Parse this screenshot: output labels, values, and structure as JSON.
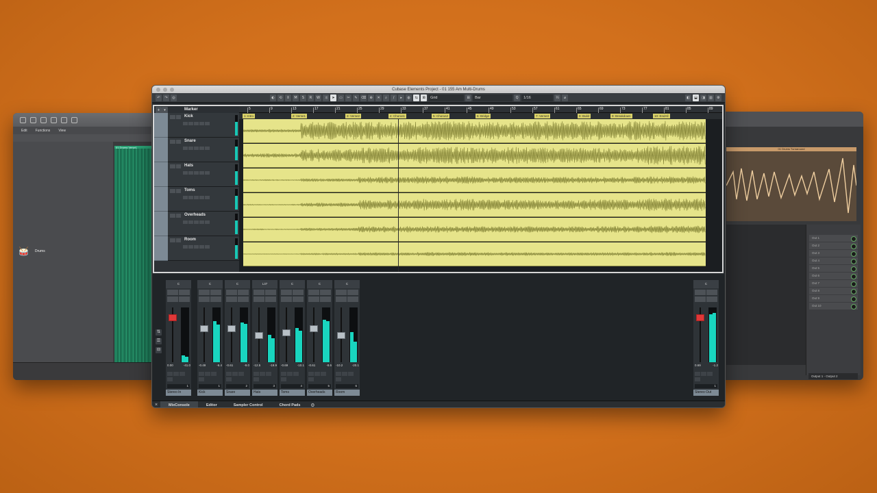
{
  "cubase": {
    "title": "Cubase Elements Project - 01 155 Am Multi-Drums",
    "toolbar": {
      "mode_buttons": [
        "M",
        "S",
        "R",
        "W"
      ],
      "snap_label": "Grid",
      "snap_type": "Bar",
      "quantize": "1/16"
    },
    "ruler": [
      "5",
      "9",
      "13",
      "17",
      "21",
      "25",
      "29",
      "33",
      "37",
      "41",
      "45",
      "49",
      "53",
      "57",
      "61",
      "65",
      "69",
      "73",
      "77",
      "81",
      "85",
      "89"
    ],
    "marker_track_label": "Marker",
    "markers": [
      "1: Intro",
      "2: Verse1",
      "3: Verse2",
      "4: Chorus1",
      "5: Chorus2",
      "6: Bridge",
      "7: Verse3",
      "8: Build",
      "9: Breakdown",
      "10: EndAll"
    ],
    "tracks": [
      "Kick",
      "Snare",
      "Hats",
      "Toms",
      "Overheads",
      "Room"
    ],
    "mixer": {
      "channels": [
        {
          "name": "Stereo In",
          "num": "1",
          "pan": "C",
          "val": "0.00",
          "peak": "-41.0"
        },
        {
          "name": "Kick",
          "num": "1",
          "pan": "C",
          "val": "-0.49",
          "peak": "-6.4"
        },
        {
          "name": "Snare",
          "num": "2",
          "pan": "C",
          "val": "-0.61",
          "peak": "-9.0"
        },
        {
          "name": "Hats",
          "num": "3",
          "pan": "L37",
          "val": "-12.5",
          "peak": "-19.9"
        },
        {
          "name": "Toms",
          "num": "4",
          "pan": "C",
          "val": "-0.69",
          "peak": "-10.1"
        },
        {
          "name": "Overheads",
          "num": "5",
          "pan": "C",
          "val": "-0.61",
          "peak": "-8.6"
        },
        {
          "name": "Room",
          "num": "6",
          "pan": "C",
          "val": "-10.2",
          "peak": "-20.1"
        },
        {
          "name": "Stereo Out",
          "num": "1",
          "pan": "C",
          "val": "0.69",
          "peak": "-1.2"
        }
      ]
    },
    "bottom_tabs": [
      "MixConsole",
      "Editor",
      "Sampler Control",
      "Chord Pads"
    ]
  },
  "logic": {
    "menus": [
      "Edit",
      "Functions",
      "View"
    ],
    "track_name": "Drums",
    "region_label": "01 Drums Verse1"
  },
  "right_window": {
    "region_label": "01 Drums Turnaround",
    "slots": [
      "Out 1",
      "Out 2",
      "Out 3",
      "Out 4",
      "Out 5",
      "Out 6",
      "Out 7",
      "Out 8",
      "Out 9",
      "Out 10"
    ],
    "output": "Output 1 - Output 2"
  },
  "colors": {
    "background": "#d2701c",
    "clip_fill": "#e6e48a",
    "meter": "#19d5bf",
    "track_strip": "#7d8a95"
  }
}
